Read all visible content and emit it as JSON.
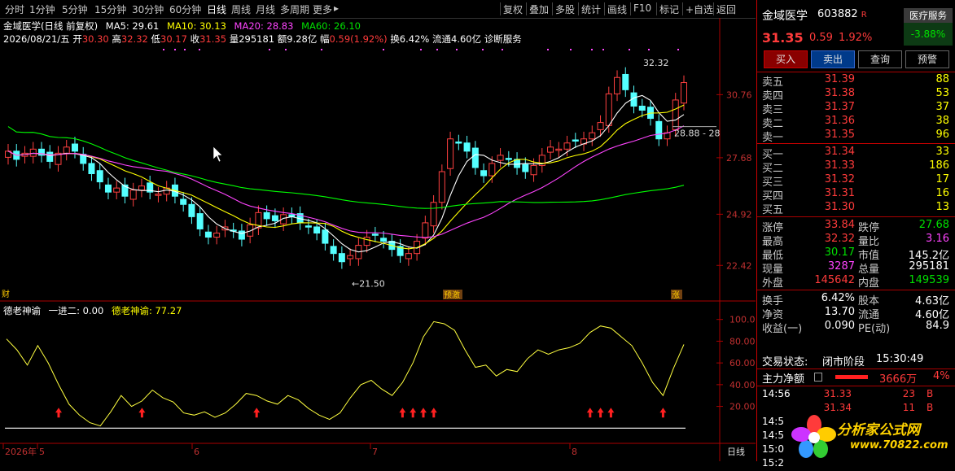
{
  "toolbar": {
    "periods": [
      "分时",
      "1分钟",
      "5分钟",
      "15分钟",
      "30分钟",
      "60分钟",
      "日线",
      "周线",
      "月线",
      "多周期",
      "更多"
    ],
    "active_period": "日线",
    "tools": [
      "复权",
      "叠加",
      "多股",
      "统计",
      "画线",
      "F10",
      "标记",
      "+自选",
      "返回"
    ]
  },
  "chart_header": {
    "title": "金域医学(日线 前复权)",
    "ma5": "MA5: 29.61",
    "ma10": "MA10: 30.13",
    "ma20": "MA20: 28.83",
    "ma60": "MA60: 26.10",
    "date": "2026/08/21/五",
    "open_label": "开",
    "open": "30.30",
    "high_label": "高",
    "high": "32.32",
    "low_label": "低",
    "low": "30.17",
    "close_label": "收",
    "close": "31.35",
    "vol_label": "量",
    "vol": "295181",
    "amount_label": "额",
    "amount": "9.28亿",
    "change_label": "幅",
    "change": "0.59(1.92%)",
    "turnover": "换6.42%",
    "float": "流通4.60亿",
    "diag": "诊断服务"
  },
  "chart_data": [
    {
      "type": "candlestick",
      "title": "金域医学(日线 前复权)",
      "y_ticks": [
        "30.76",
        "27.68",
        "24.92",
        "22.42"
      ],
      "annotations": [
        "32.32",
        "28.88 - 28",
        "←21.50"
      ],
      "markers": [
        "财",
        "预激",
        "涨"
      ],
      "series": [
        {
          "name": "MA5",
          "value": 29.61,
          "color": "#ffffff"
        },
        {
          "name": "MA10",
          "value": 30.13,
          "color": "#ffff00"
        },
        {
          "name": "MA20",
          "value": 28.83,
          "color": "#ff44ff"
        },
        {
          "name": "MA60",
          "value": 26.1,
          "color": "#00ff00"
        }
      ],
      "close_values": [
        28.0,
        27.6,
        27.9,
        28.1,
        27.8,
        27.5,
        27.9,
        28.2,
        28.0,
        27.4,
        26.9,
        26.5,
        26.0,
        26.2,
        25.8,
        26.1,
        26.3,
        26.0,
        25.9,
        26.2,
        25.8,
        25.4,
        24.8,
        24.2,
        23.8,
        24.0,
        24.3,
        24.1,
        23.7,
        24.4,
        25.0,
        24.7,
        24.6,
        24.9,
        24.8,
        24.5,
        24.3,
        24.0,
        23.5,
        23.0,
        22.6,
        22.9,
        23.4,
        23.8,
        23.9,
        23.6,
        23.2,
        22.9,
        23.0,
        23.6,
        24.5,
        25.5,
        27.0,
        28.6,
        28.4,
        28.0,
        27.2,
        26.8,
        27.4,
        27.8,
        27.6,
        27.2,
        27.0,
        27.3,
        27.8,
        28.2,
        28.1,
        28.4,
        28.5,
        28.6,
        28.9,
        29.4,
        30.8,
        31.6,
        31.0,
        30.2,
        30.0,
        29.6,
        28.6,
        28.9,
        30.5,
        31.35
      ]
    },
    {
      "type": "line",
      "title": "德老神谕",
      "indicator_name": "德老神谕",
      "indicator_sub": "一进二: 0.00",
      "indicator_value": "德老神谕: 77.27",
      "y_ticks": [
        "100.0",
        "80.00",
        "60.00",
        "40.00",
        "20.00"
      ],
      "x_labels": [
        "2026年",
        "5",
        "6",
        "7",
        "8"
      ],
      "period_label": "日线",
      "values": [
        82,
        72,
        58,
        76,
        60,
        40,
        22,
        12,
        5,
        2,
        15,
        30,
        20,
        25,
        35,
        28,
        24,
        14,
        12,
        15,
        10,
        14,
        22,
        32,
        30,
        25,
        22,
        30,
        26,
        18,
        12,
        8,
        14,
        28,
        40,
        44,
        36,
        30,
        42,
        60,
        84,
        98,
        96,
        90,
        72,
        56,
        58,
        48,
        54,
        52,
        64,
        72,
        68,
        72,
        74,
        78,
        88,
        94,
        92,
        84,
        76,
        60,
        42,
        30,
        55,
        77
      ],
      "arrow_indices": [
        5,
        13,
        24,
        38,
        39,
        40,
        41,
        56,
        57,
        58,
        63
      ]
    }
  ],
  "quote": {
    "name": "金域医学",
    "code": "603882",
    "r_mark": "R",
    "sector": "医疗服务",
    "sector_change": "-3.88%",
    "price": "31.35",
    "change": "0.59",
    "change_pct": "1.92%",
    "buttons": [
      "买入",
      "卖出",
      "查询",
      "预警"
    ]
  },
  "order_book": {
    "asks": [
      {
        "label": "卖五",
        "price": "31.39",
        "vol": "88"
      },
      {
        "label": "卖四",
        "price": "31.38",
        "vol": "53"
      },
      {
        "label": "卖三",
        "price": "31.37",
        "vol": "37"
      },
      {
        "label": "卖二",
        "price": "31.36",
        "vol": "38"
      },
      {
        "label": "卖一",
        "price": "31.35",
        "vol": "96"
      }
    ],
    "bids": [
      {
        "label": "买一",
        "price": "31.34",
        "vol": "33"
      },
      {
        "label": "买二",
        "price": "31.33",
        "vol": "186"
      },
      {
        "label": "买三",
        "price": "31.32",
        "vol": "17"
      },
      {
        "label": "买四",
        "price": "31.31",
        "vol": "16"
      },
      {
        "label": "买五",
        "price": "31.30",
        "vol": "13"
      }
    ]
  },
  "stats": [
    {
      "l1": "涨停",
      "v1": "33.84",
      "l2": "跌停",
      "v2": "27.68"
    },
    {
      "l1": "最高",
      "v1": "32.32",
      "l2": "量比",
      "v2": "3.16"
    },
    {
      "l1": "最低",
      "v1": "30.17",
      "l2": "市值",
      "v2": "145.2亿"
    },
    {
      "l1": "现量",
      "v1": "3287",
      "l2": "总量",
      "v2": "295181"
    },
    {
      "l1": "外盘",
      "v1": "145642",
      "l2": "内盘",
      "v2": "149539"
    }
  ],
  "stats2": [
    {
      "l1": "换手",
      "v1": "6.42%",
      "l2": "股本",
      "v2": "4.63亿"
    },
    {
      "l1": "净资",
      "v1": "13.70",
      "l2": "流通",
      "v2": "4.60亿"
    },
    {
      "l1": "收益(一)",
      "v1": "0.090",
      "l2": "PE(动)",
      "v2": "84.9"
    }
  ],
  "trade_status": {
    "label": "交易状态:",
    "state": "闭市阶段",
    "time": "15:30:49"
  },
  "main_force": {
    "label": "主力净额",
    "value": "3666万",
    "pct": "4%"
  },
  "ticks": [
    {
      "time": "14:56",
      "price": "31.33",
      "vol": "23",
      "dir": "B"
    },
    {
      "time": "",
      "price": "31.34",
      "vol": "11",
      "dir": "B"
    },
    {
      "time": "14:5",
      "price": "",
      "vol": "",
      "dir": ""
    },
    {
      "time": "14:5",
      "price": "",
      "vol": "",
      "dir": ""
    },
    {
      "time": "15:0",
      "price": "",
      "vol": "",
      "dir": ""
    },
    {
      "time": "15:2",
      "price": "",
      "vol": "",
      "dir": ""
    }
  ],
  "logo": {
    "text": "分析家公式网",
    "url": "www.70822.com"
  }
}
